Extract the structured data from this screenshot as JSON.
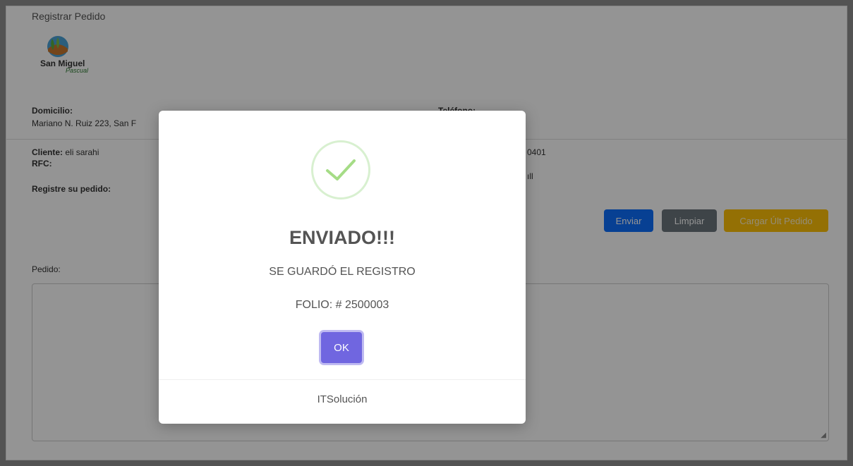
{
  "page": {
    "title": "Registrar Pedido",
    "logo_text": "San Miguel",
    "logo_script": "Pascual",
    "domicilio_label": "Domicilio:",
    "domicilio_value": "Mariano N. Ruiz 223, San F",
    "telefono_label": "Teléfono:",
    "cliente_label": "Cliente:",
    "cliente_value": "eli sarahi",
    "rfc_label": "RFC:",
    "telefono_value_partial": "0401",
    "email_value_partial": "ıll",
    "registre_label": "Registre su pedido:",
    "pedido_label": "Pedido:",
    "buttons": {
      "send": "Enviar",
      "clear": "Limpiar",
      "load_last": "Cargar Últ Pedido"
    },
    "resize_icon": "resize-handle-icon"
  },
  "modal": {
    "title": "ENVIADO!!!",
    "message": "SE GUARDÓ EL REGISTRO",
    "folio": "FOLIO: # 2500003",
    "ok_label": "OK",
    "footer": "ITSolución",
    "icon": "success-check-icon"
  },
  "colors": {
    "primary": "#0d6efd",
    "secondary": "#6c757d",
    "warning": "#ffc107",
    "ok_button": "#7066e0",
    "success": "#a5dc86"
  }
}
